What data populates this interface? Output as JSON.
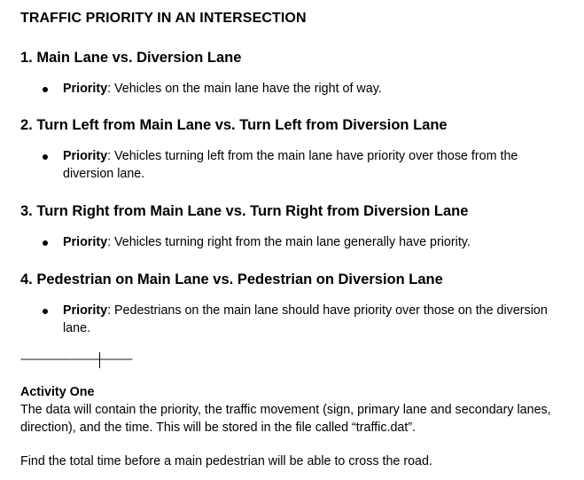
{
  "document": {
    "title": "TRAFFIC PRIORITY IN AN INTERSECTION",
    "sections": [
      {
        "heading": "1. Main Lane vs. Diversion Lane",
        "bullet_term": "Priority",
        "bullet_text": ": Vehicles on the main lane have the right of way."
      },
      {
        "heading": "2. Turn Left from Main Lane vs. Turn Left from Diversion Lane",
        "bullet_term": "Priority",
        "bullet_text": ": Vehicles turning left from the main lane have priority over those from the diversion lane."
      },
      {
        "heading": "3. Turn Right from Main Lane vs. Turn Right from Diversion Lane",
        "bullet_term": "Priority",
        "bullet_text": ": Vehicles turning right from the main lane generally have priority."
      },
      {
        "heading": "4. Pedestrian on Main Lane vs. Pedestrian on Diversion Lane",
        "bullet_term": "Priority",
        "bullet_text": ": Pedestrians on the main lane should have priority over those on the diversion lane."
      }
    ],
    "divider": "------------------------------------------",
    "activity": {
      "heading": "Activity One",
      "body": "The data will contain the priority, the traffic movement (sign, primary lane and secondary lanes, direction), and the time. This will be stored in the file called “traffic.dat”.",
      "task": "Find the total time before a main pedestrian will be able to cross the road."
    }
  }
}
